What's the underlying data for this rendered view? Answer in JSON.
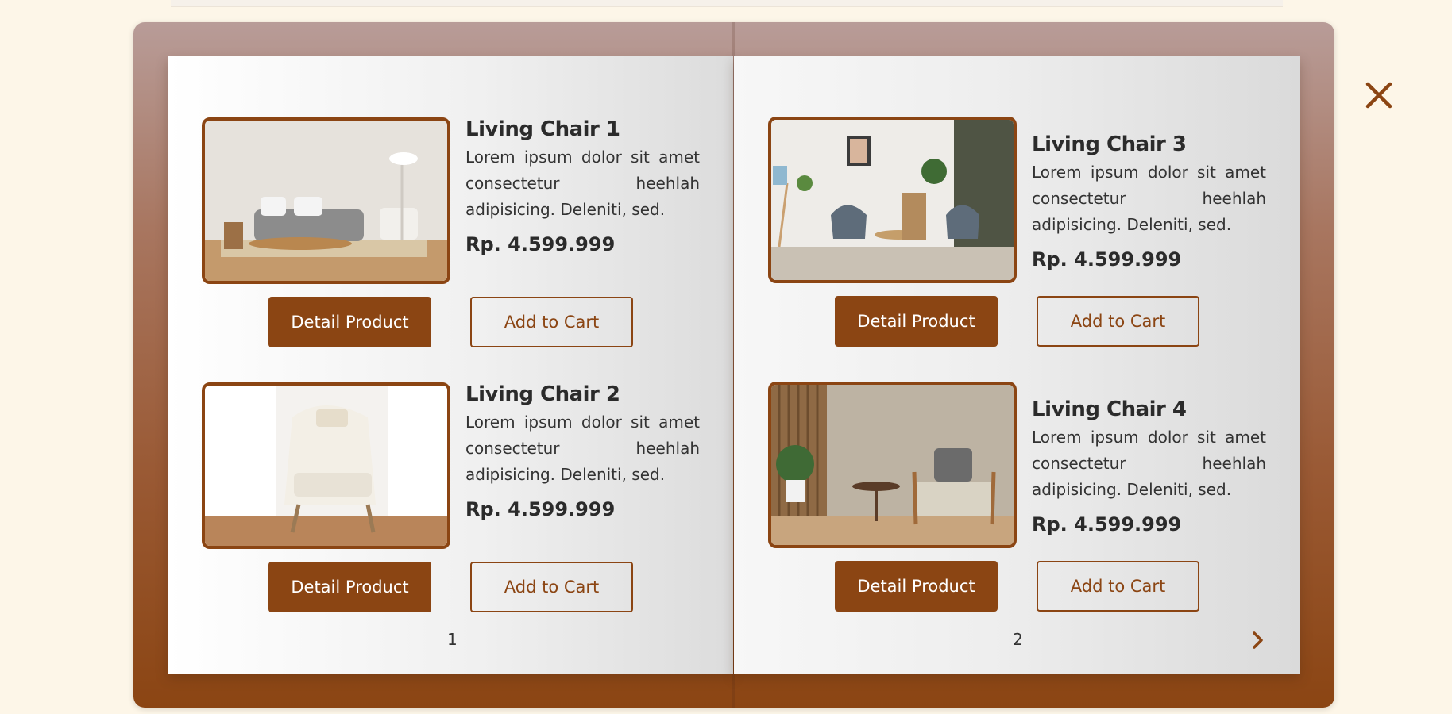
{
  "catalog": {
    "products": [
      {
        "title": "Living Chair 1",
        "description": "Lorem ipsum dolor sit amet consectetur heehlah adipisicing. Deleniti, sed.",
        "price": "Rp. 4.599.999",
        "detail_label": "Detail Product",
        "cart_label": "Add to Cart"
      },
      {
        "title": "Living Chair 2",
        "description": "Lorem ipsum dolor sit amet consectetur heehlah adipisicing. Deleniti, sed.",
        "price": "Rp. 4.599.999",
        "detail_label": "Detail Product",
        "cart_label": "Add to Cart"
      },
      {
        "title": "Living Chair 3",
        "description": "Lorem ipsum dolor sit amet consectetur heehlah adipisicing. Deleniti, sed.",
        "price": "Rp. 4.599.999",
        "detail_label": "Detail Product",
        "cart_label": "Add to Cart"
      },
      {
        "title": "Living Chair 4",
        "description": "Lorem ipsum dolor sit amet consectetur heehlah adipisicing. Deleniti, sed.",
        "price": "Rp. 4.599.999",
        "detail_label": "Detail Product",
        "cart_label": "Add to Cart"
      }
    ],
    "pages": [
      {
        "number": "1"
      },
      {
        "number": "2"
      }
    ],
    "icons": {
      "close": "close-icon",
      "next": "chevron-right-icon"
    },
    "colors": {
      "accent": "#8b4513",
      "background": "#fdf6e8"
    }
  }
}
